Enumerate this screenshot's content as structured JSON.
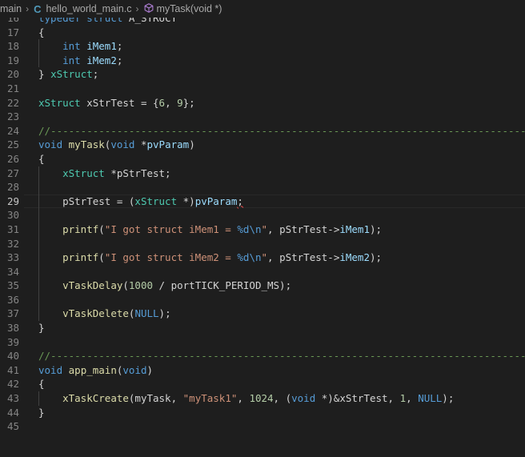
{
  "breadcrumb": {
    "folder": "main",
    "file": "hello_world_main.c",
    "symbol": "myTask(void *)",
    "file_icon": "c-file-icon",
    "symbol_icon": "function-cube-icon"
  },
  "editor": {
    "current_line": 29,
    "lines": [
      {
        "n": "16",
        "code": "typedef struct A_STRUCT"
      },
      {
        "n": "17",
        "code": "{"
      },
      {
        "n": "18",
        "code": "    int iMem1;"
      },
      {
        "n": "19",
        "code": "    int iMem2;"
      },
      {
        "n": "20",
        "code": "} xStruct;"
      },
      {
        "n": "21",
        "code": ""
      },
      {
        "n": "22",
        "code": "xStruct xStrTest = {6, 9};"
      },
      {
        "n": "23",
        "code": ""
      },
      {
        "n": "24",
        "code": "//---------------------------------------------------------------------------------------------"
      },
      {
        "n": "25",
        "code": "void myTask(void *pvParam)"
      },
      {
        "n": "26",
        "code": "{"
      },
      {
        "n": "27",
        "code": "    xStruct *pStrTest;"
      },
      {
        "n": "28",
        "code": ""
      },
      {
        "n": "29",
        "code": "    pStrTest = (xStruct *)pvParam;"
      },
      {
        "n": "30",
        "code": ""
      },
      {
        "n": "31",
        "code": "    printf(\"I got struct iMem1 = %d\\n\", pStrTest->iMem1);"
      },
      {
        "n": "32",
        "code": ""
      },
      {
        "n": "33",
        "code": "    printf(\"I got struct iMem2 = %d\\n\", pStrTest->iMem2);"
      },
      {
        "n": "34",
        "code": ""
      },
      {
        "n": "35",
        "code": "    vTaskDelay(1000 / portTICK_PERIOD_MS);"
      },
      {
        "n": "36",
        "code": ""
      },
      {
        "n": "37",
        "code": "    vTaskDelete(NULL);"
      },
      {
        "n": "38",
        "code": "}"
      },
      {
        "n": "39",
        "code": ""
      },
      {
        "n": "40",
        "code": "//---------------------------------------------------------------------------------------------"
      },
      {
        "n": "41",
        "code": "void app_main(void)"
      },
      {
        "n": "42",
        "code": "{"
      },
      {
        "n": "43",
        "code": "    xTaskCreate(myTask, \"myTask1\", 1024, (void *)&xStrTest, 1, NULL);"
      },
      {
        "n": "44",
        "code": "}"
      },
      {
        "n": "45",
        "code": ""
      }
    ]
  },
  "colors": {
    "background": "#1e1e1e",
    "keyword": "#569cd6",
    "type": "#4ec9b0",
    "function": "#dcdcaa",
    "variable": "#9cdcfe",
    "string": "#ce9178",
    "number": "#b5cea8",
    "comment": "#6a9955",
    "line_number": "#858585",
    "error_squiggle": "#f14c4c"
  }
}
